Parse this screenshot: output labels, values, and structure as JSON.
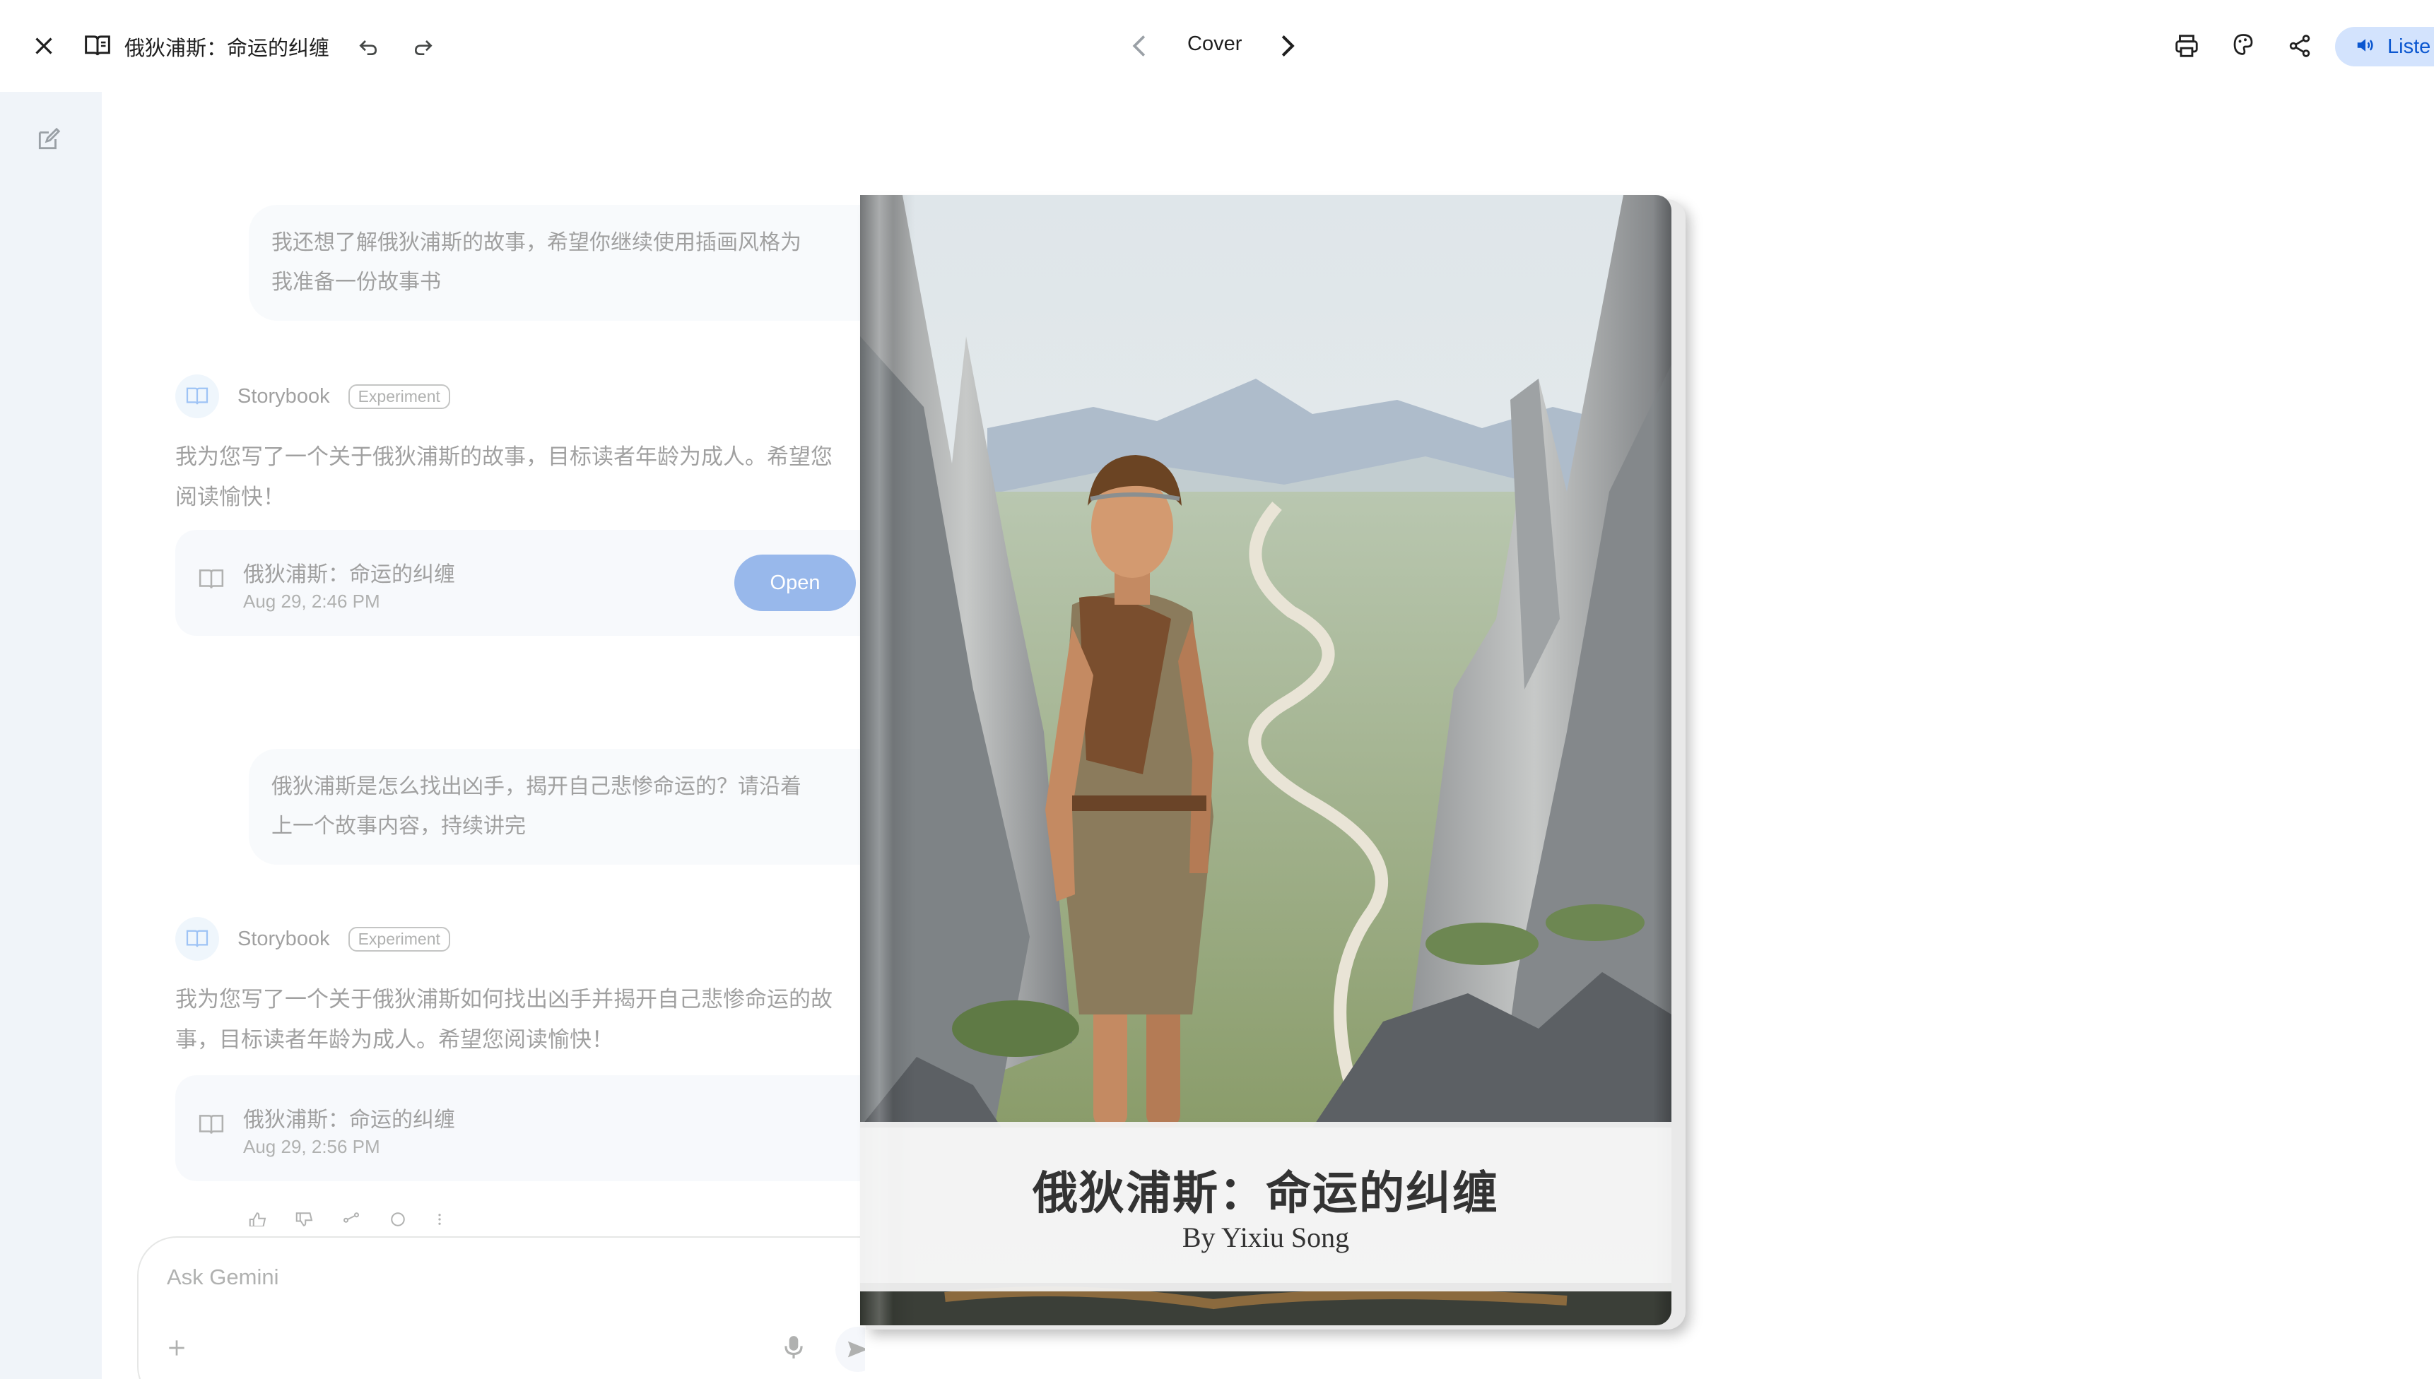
{
  "header": {
    "title": "俄狄浦斯：命运的纠缠",
    "page_label": "Cover",
    "listen_label": "Liste"
  },
  "chat": {
    "messages": [
      {
        "role": "user",
        "text_line1": "我还想了解俄狄浦斯的故事，希望你继续使用插画风格为",
        "text_line2": "我准备一份故事书"
      },
      {
        "role": "ai",
        "name": "Storybook",
        "badge": "Experiment",
        "text_line1": "我为您写了一个关于俄狄浦斯的故事，目标读者年龄为成人。希望您",
        "text_line2": "阅读愉快！",
        "card": {
          "title": "俄狄浦斯：命运的纠缠",
          "date": "Aug 29, 2:46 PM",
          "button": "Open"
        }
      },
      {
        "role": "user",
        "text_line1": "俄狄浦斯是怎么找出凶手，揭开自己悲惨命运的？请沿着",
        "text_line2": "上一个故事内容，持续讲完"
      },
      {
        "role": "ai",
        "name": "Storybook",
        "badge": "Experiment",
        "text_line1": "我为您写了一个关于俄狄浦斯如何找出凶手并揭开自己悲惨命运的故",
        "text_line2": "事，目标读者年龄为成人。希望您阅读愉快！",
        "card": {
          "title": "俄狄浦斯：命运的纠缠",
          "date": "Aug 29, 2:56 PM"
        }
      }
    ],
    "input_placeholder": "Ask Gemini"
  },
  "book": {
    "title": "俄狄浦斯：命运的纠缠",
    "author": "By Yixiu Song"
  },
  "icons": {
    "close": "close-icon",
    "book": "book-icon",
    "undo": "undo-icon",
    "redo": "redo-icon",
    "prev": "chevron-left-icon",
    "next": "chevron-right-icon",
    "print": "print-icon",
    "theme": "palette-icon",
    "share": "share-icon",
    "volume": "volume-icon",
    "new_chat": "edit-icon"
  },
  "colors": {
    "accent": "#0b57d0",
    "accent_light": "#d3e3fd",
    "sidebar": "#f0f4f9"
  }
}
